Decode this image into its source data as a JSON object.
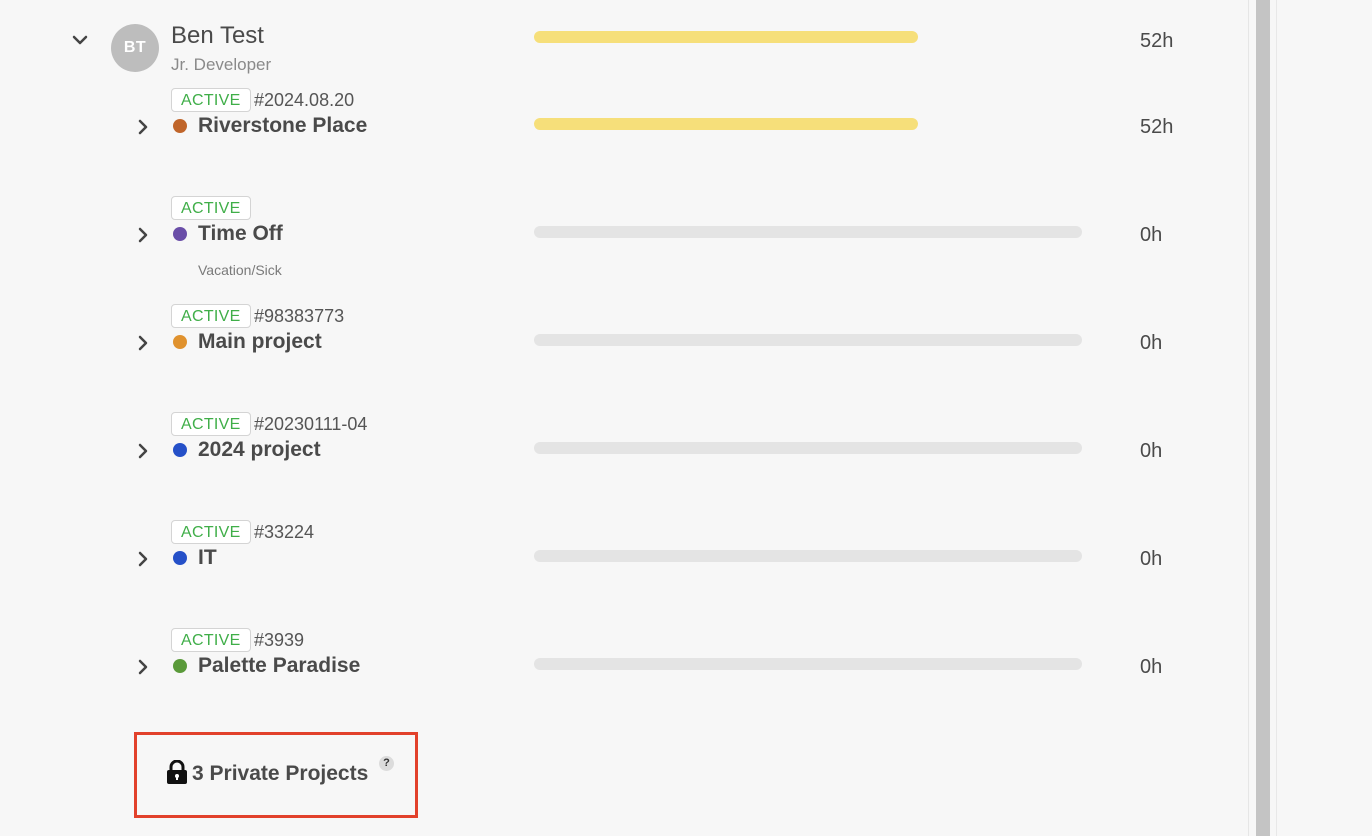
{
  "user": {
    "initials": "BT",
    "name": "Ben Test",
    "role": "Jr. Developer",
    "hours": "52h",
    "progress": 0.7,
    "bar_color": "#f6df7a"
  },
  "projects": [
    {
      "status": "ACTIVE",
      "code": "#2024.08.20",
      "name": "Riverstone Place",
      "subtitle": "",
      "dot_color": "#c0652a",
      "hours": "52h",
      "progress": 0.7,
      "bar_color": "#f6df7a"
    },
    {
      "status": "ACTIVE",
      "code": "",
      "name": "Time Off",
      "subtitle": "Vacation/Sick",
      "dot_color": "#6a4ea8",
      "hours": "0h",
      "progress": 0,
      "bar_color": "#e4e4e4"
    },
    {
      "status": "ACTIVE",
      "code": "#98383773",
      "name": "Main project",
      "subtitle": "",
      "dot_color": "#e0922e",
      "hours": "0h",
      "progress": 0,
      "bar_color": "#e4e4e4"
    },
    {
      "status": "ACTIVE",
      "code": "#20230111-04",
      "name": "2024 project",
      "subtitle": "",
      "dot_color": "#2550c8",
      "hours": "0h",
      "progress": 0,
      "bar_color": "#e4e4e4"
    },
    {
      "status": "ACTIVE",
      "code": "#33224",
      "name": "IT",
      "subtitle": "",
      "dot_color": "#2550c8",
      "hours": "0h",
      "progress": 0,
      "bar_color": "#e4e4e4"
    },
    {
      "status": "ACTIVE",
      "code": "#3939",
      "name": "Palette Paradise",
      "subtitle": "",
      "dot_color": "#5a9a3a",
      "hours": "0h",
      "progress": 0,
      "bar_color": "#e4e4e4"
    }
  ],
  "private_projects": {
    "label": "3 Private Projects",
    "help": "?"
  },
  "icons": {
    "collapse": "chevron-down-icon",
    "expand": "chevron-right-icon",
    "lock": "lock-icon",
    "help": "question-icon"
  }
}
